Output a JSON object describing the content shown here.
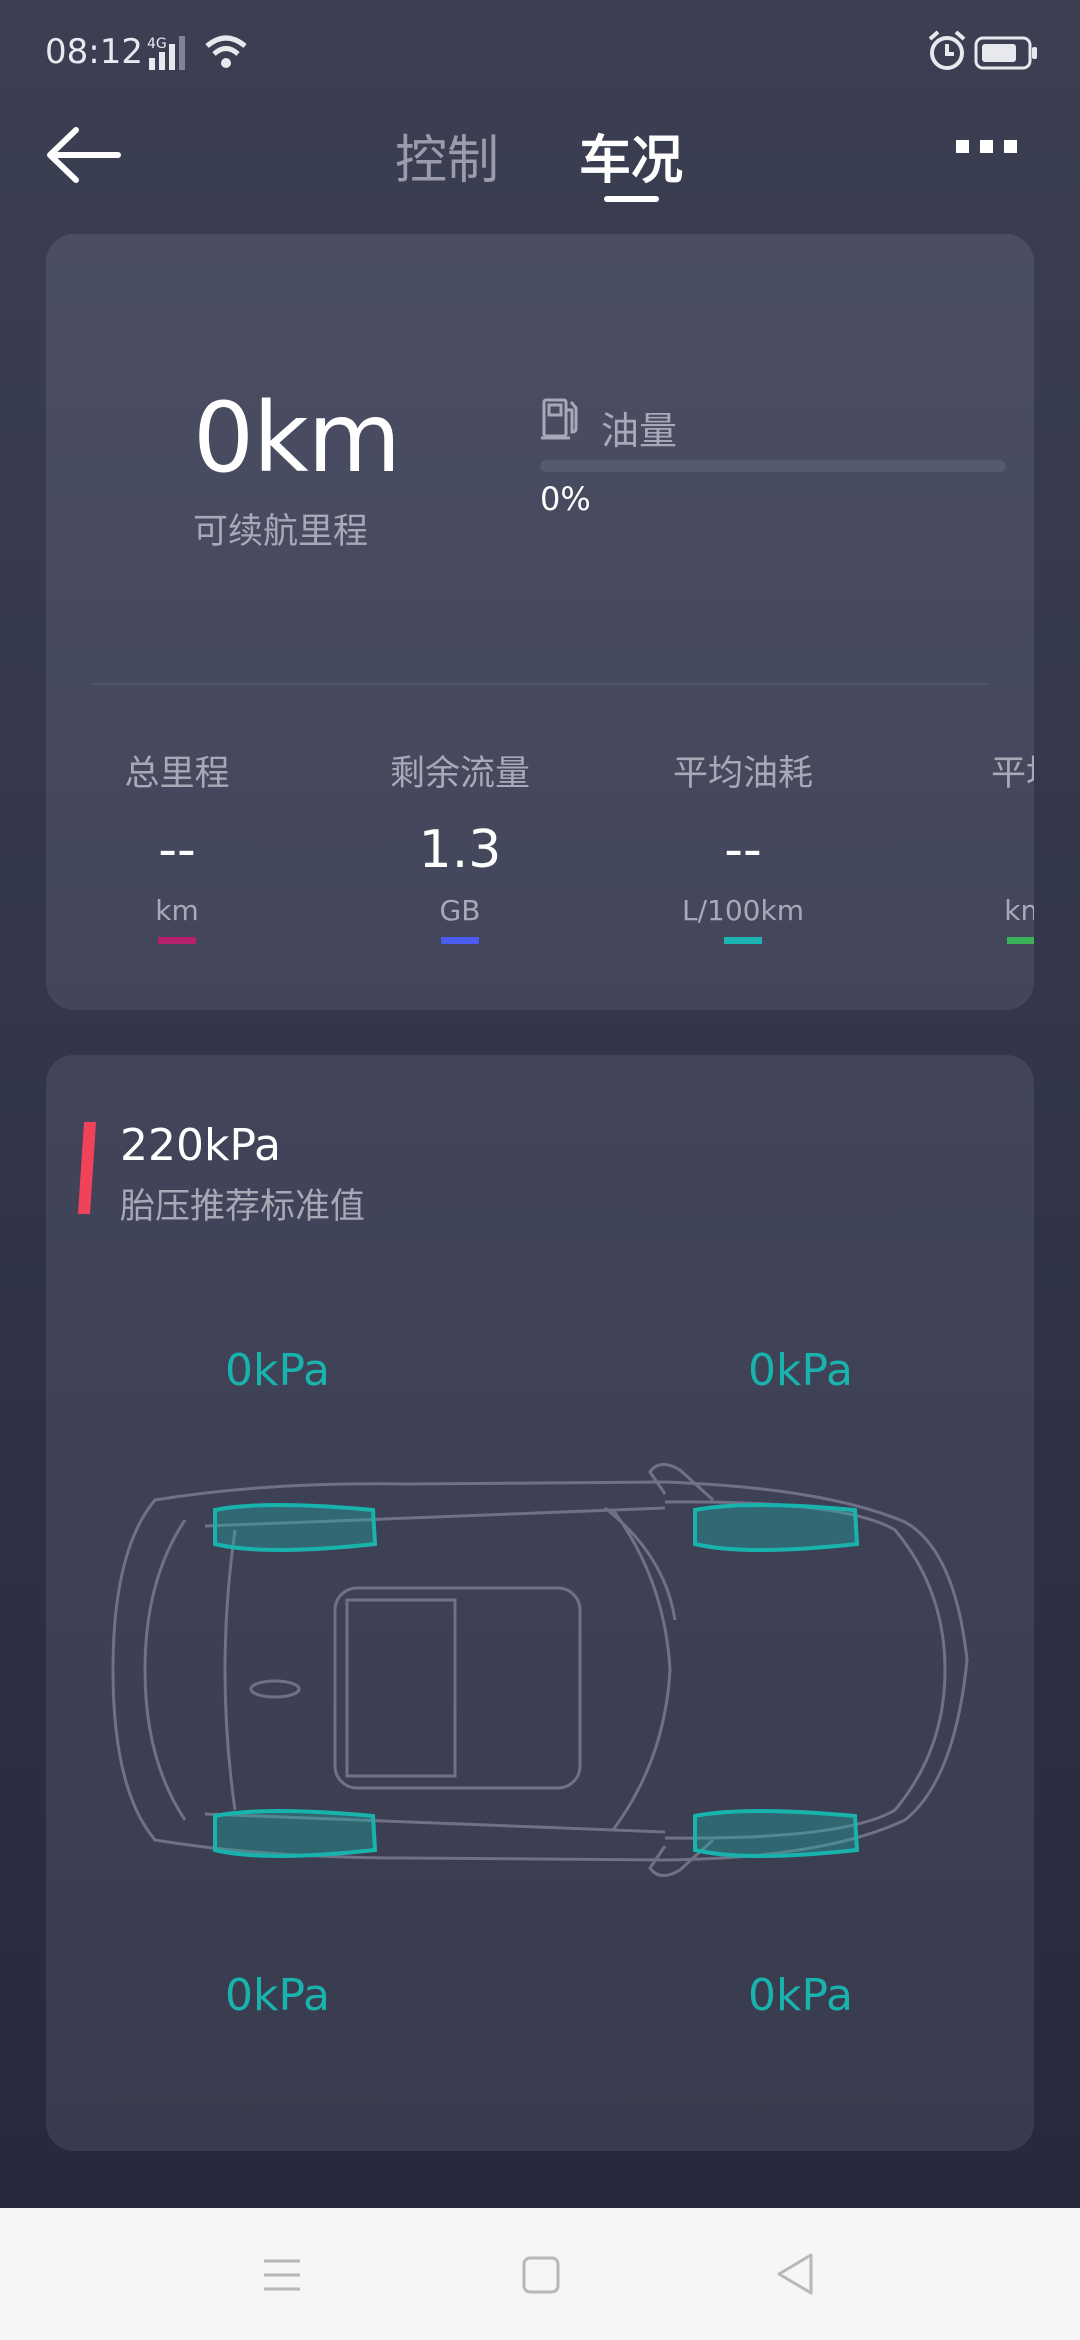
{
  "status_bar": {
    "time": "08:12",
    "network": "4G"
  },
  "header": {
    "tabs": [
      {
        "label": "控制",
        "active": false
      },
      {
        "label": "车况",
        "active": true
      }
    ]
  },
  "summary": {
    "range_value": "0km",
    "range_label": "可续航里程",
    "fuel_label": "油量",
    "fuel_percent": "0%",
    "fuel_level": 0
  },
  "stats": [
    {
      "title": "总里程",
      "value": "--",
      "unit": "km",
      "color": "#b5206a"
    },
    {
      "title": "剩余流量",
      "value": "1.3",
      "unit": "GB",
      "color": "#4b5cf0"
    },
    {
      "title": "平均油耗",
      "value": "--",
      "unit": "L/100km",
      "color": "#1bb4b0"
    },
    {
      "title": "平均",
      "value": "",
      "unit": "km",
      "color": "#3ab15a"
    }
  ],
  "tyre": {
    "standard_value": "220kPa",
    "standard_label": "胎压推荐标准值",
    "front_left": "0kPa",
    "front_right": "0kPa",
    "rear_left": "0kPa",
    "rear_right": "0kPa"
  },
  "colors": {
    "accent_teal": "#19b3ad",
    "accent_red": "#f0435a"
  },
  "icons": [
    "back-arrow-icon",
    "more-icon",
    "fuel-pump-icon",
    "alarm-icon",
    "battery-icon",
    "wifi-icon",
    "signal-icon"
  ]
}
